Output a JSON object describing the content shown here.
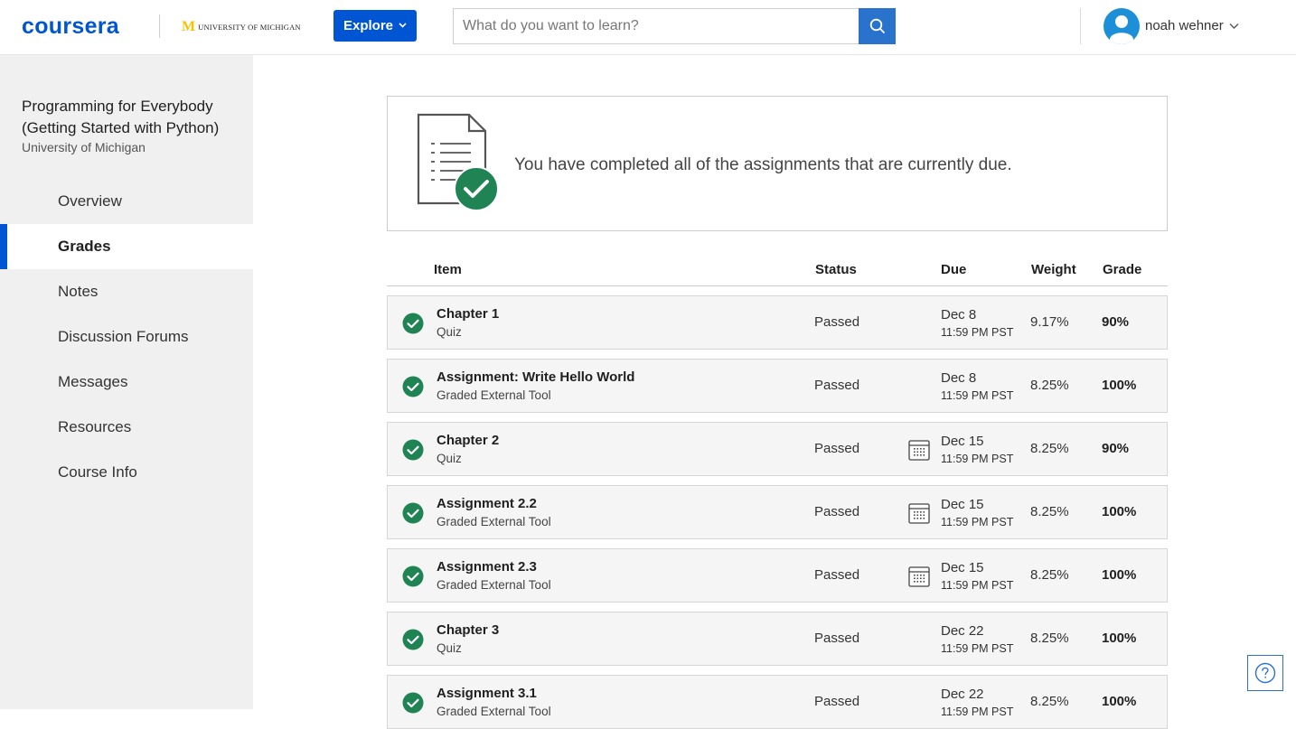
{
  "header": {
    "logo": "coursera",
    "partner_mark": "M",
    "partner_text": "UNIVERSITY OF MICHIGAN",
    "explore_label": "Explore",
    "search_placeholder": "What do you want to learn?",
    "username": "noah wehner"
  },
  "sidebar": {
    "course_title": "Programming for Everybody (Getting Started with Python)",
    "course_org": "University of Michigan",
    "items": [
      {
        "label": "Overview",
        "active": false
      },
      {
        "label": "Grades",
        "active": true
      },
      {
        "label": "Notes",
        "active": false
      },
      {
        "label": "Discussion Forums",
        "active": false
      },
      {
        "label": "Messages",
        "active": false
      },
      {
        "label": "Resources",
        "active": false
      },
      {
        "label": "Course Info",
        "active": false
      }
    ]
  },
  "banner": {
    "message": "You have completed all of the assignments that are currently due."
  },
  "table": {
    "headers": {
      "item": "Item",
      "status": "Status",
      "due": "Due",
      "weight": "Weight",
      "grade": "Grade"
    },
    "rows": [
      {
        "name": "Chapter 1",
        "type": "Quiz",
        "status": "Passed",
        "due": "Dec 8",
        "due_time": "11:59 PM PST",
        "weight": "9.17%",
        "grade": "90%",
        "calendar_icon": false
      },
      {
        "name": "Assignment: Write Hello World",
        "type": "Graded External Tool",
        "status": "Passed",
        "due": "Dec 8",
        "due_time": "11:59 PM PST",
        "weight": "8.25%",
        "grade": "100%",
        "calendar_icon": false
      },
      {
        "name": "Chapter 2",
        "type": "Quiz",
        "status": "Passed",
        "due": "Dec 15",
        "due_time": "11:59 PM PST",
        "weight": "8.25%",
        "grade": "90%",
        "calendar_icon": true
      },
      {
        "name": "Assignment 2.2",
        "type": "Graded External Tool",
        "status": "Passed",
        "due": "Dec 15",
        "due_time": "11:59 PM PST",
        "weight": "8.25%",
        "grade": "100%",
        "calendar_icon": true
      },
      {
        "name": "Assignment 2.3",
        "type": "Graded External Tool",
        "status": "Passed",
        "due": "Dec 15",
        "due_time": "11:59 PM PST",
        "weight": "8.25%",
        "grade": "100%",
        "calendar_icon": true
      },
      {
        "name": "Chapter 3",
        "type": "Quiz",
        "status": "Passed",
        "due": "Dec 22",
        "due_time": "11:59 PM PST",
        "weight": "8.25%",
        "grade": "100%",
        "calendar_icon": false
      },
      {
        "name": "Assignment 3.1",
        "type": "Graded External Tool",
        "status": "Passed",
        "due": "Dec 22",
        "due_time": "11:59 PM PST",
        "weight": "8.25%",
        "grade": "100%",
        "calendar_icon": false
      }
    ]
  },
  "colors": {
    "brand": "#0056d2",
    "success": "#1f8354",
    "sidebar_bg": "#f0f0f0"
  },
  "icons": {
    "search": "search-icon",
    "avatar": "user-avatar-icon",
    "check": "check-circle-icon",
    "calendar": "calendar-icon",
    "help": "help-icon"
  }
}
